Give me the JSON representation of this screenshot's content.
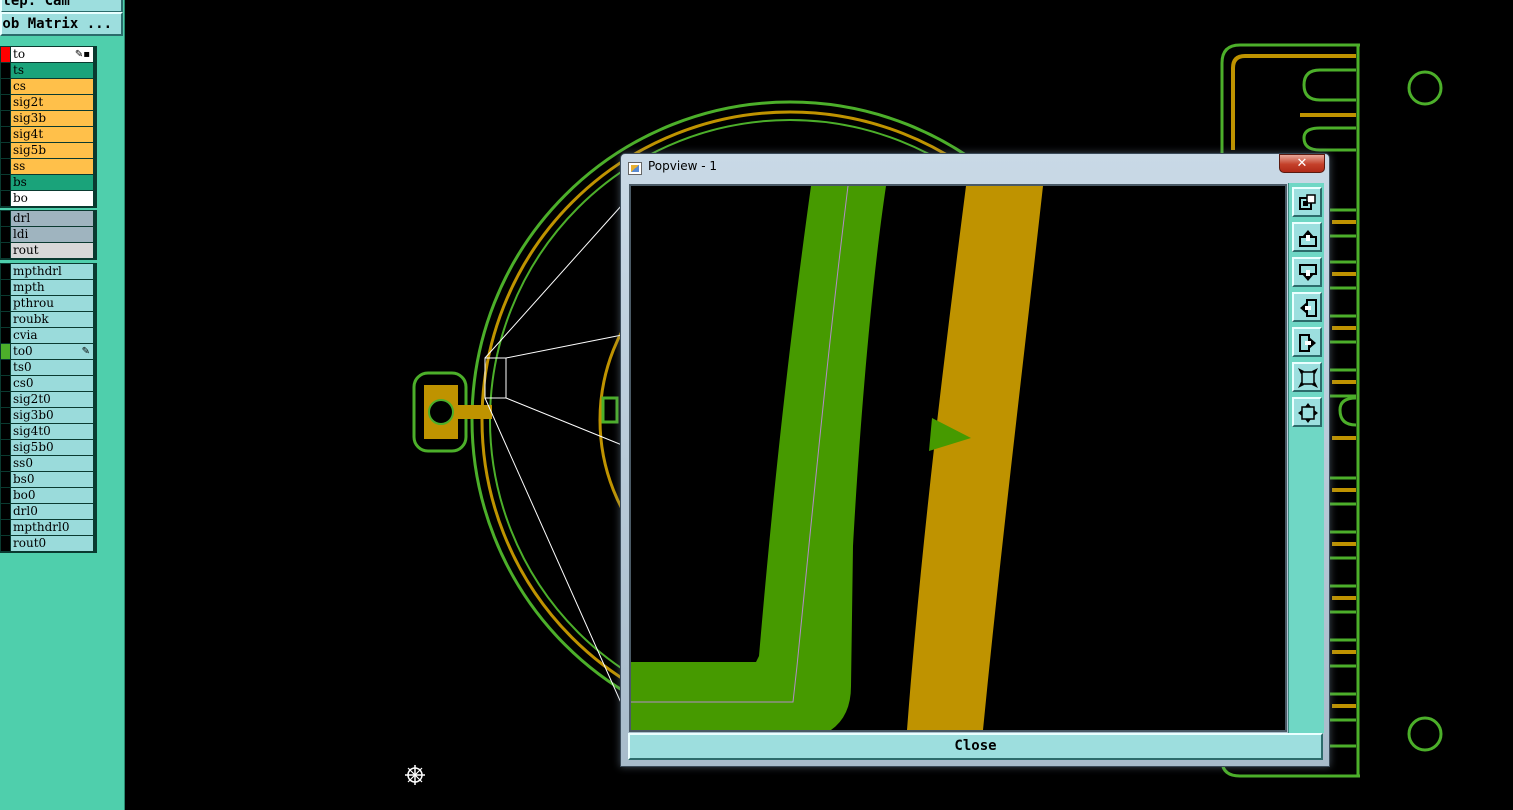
{
  "left_panel": {
    "step_button": "Step. Cam",
    "matrix_button": "Job Matrix ...",
    "groups": [
      {
        "rows": [
          {
            "name": "to",
            "bg": "#ffffff",
            "flag": "#ff0000",
            "mark": "✎▪"
          },
          {
            "name": "ts",
            "bg": "#1aa37a",
            "flag": "#000000",
            "mark": ""
          },
          {
            "name": "cs",
            "bg": "#ffc04a",
            "flag": "#000000",
            "mark": ""
          },
          {
            "name": "sig2t",
            "bg": "#ffc04a",
            "flag": "#000000",
            "mark": ""
          },
          {
            "name": "sig3b",
            "bg": "#ffc04a",
            "flag": "#000000",
            "mark": ""
          },
          {
            "name": "sig4t",
            "bg": "#ffc04a",
            "flag": "#000000",
            "mark": ""
          },
          {
            "name": "sig5b",
            "bg": "#ffc04a",
            "flag": "#000000",
            "mark": ""
          },
          {
            "name": "ss",
            "bg": "#ffc04a",
            "flag": "#000000",
            "mark": ""
          },
          {
            "name": "bs",
            "bg": "#1aa37a",
            "flag": "#000000",
            "mark": ""
          },
          {
            "name": "bo",
            "bg": "#ffffff",
            "flag": "#000000",
            "mark": ""
          }
        ]
      },
      {
        "rows": [
          {
            "name": "drl",
            "bg": "#9fb4bf",
            "flag": "#000000",
            "mark": ""
          },
          {
            "name": "ldi",
            "bg": "#9fb4bf",
            "flag": "#000000",
            "mark": ""
          },
          {
            "name": "rout",
            "bg": "#d8d8d8",
            "flag": "#000000",
            "mark": ""
          }
        ]
      },
      {
        "rows": [
          {
            "name": "mpthdrl",
            "bg": "#9adbdb",
            "flag": "#000000",
            "mark": ""
          },
          {
            "name": "mpth",
            "bg": "#9adbdb",
            "flag": "#000000",
            "mark": ""
          },
          {
            "name": "pthrou",
            "bg": "#9adbdb",
            "flag": "#000000",
            "mark": ""
          },
          {
            "name": "roubk",
            "bg": "#9adbdb",
            "flag": "#000000",
            "mark": ""
          },
          {
            "name": "cvia",
            "bg": "#9adbdb",
            "flag": "#000000",
            "mark": ""
          },
          {
            "name": "to0",
            "bg": "#9adbdb",
            "flag": "#4caf2a",
            "mark": "✎"
          },
          {
            "name": "ts0",
            "bg": "#9adbdb",
            "flag": "#000000",
            "mark": ""
          },
          {
            "name": "cs0",
            "bg": "#9adbdb",
            "flag": "#000000",
            "mark": ""
          },
          {
            "name": "sig2t0",
            "bg": "#9adbdb",
            "flag": "#000000",
            "mark": ""
          },
          {
            "name": "sig3b0",
            "bg": "#9adbdb",
            "flag": "#000000",
            "mark": ""
          },
          {
            "name": "sig4t0",
            "bg": "#9adbdb",
            "flag": "#000000",
            "mark": ""
          },
          {
            "name": "sig5b0",
            "bg": "#9adbdb",
            "flag": "#000000",
            "mark": ""
          },
          {
            "name": "ss0",
            "bg": "#9adbdb",
            "flag": "#000000",
            "mark": ""
          },
          {
            "name": "bs0",
            "bg": "#9adbdb",
            "flag": "#000000",
            "mark": ""
          },
          {
            "name": "bo0",
            "bg": "#9adbdb",
            "flag": "#000000",
            "mark": ""
          },
          {
            "name": "drl0",
            "bg": "#9adbdb",
            "flag": "#000000",
            "mark": ""
          },
          {
            "name": "mpthdrl0",
            "bg": "#9adbdb",
            "flag": "#000000",
            "mark": ""
          },
          {
            "name": "rout0",
            "bg": "#9adbdb",
            "flag": "#000000",
            "mark": ""
          }
        ]
      }
    ]
  },
  "popview": {
    "title": "Popview - 1",
    "close_x": "✕",
    "close_label": "Close",
    "tools": [
      "zoom-home-icon",
      "pan-up-icon",
      "pan-down-icon",
      "pan-left-icon",
      "pan-right-icon",
      "zoom-in-icon",
      "zoom-out-icon"
    ]
  },
  "colors": {
    "copper_green": "#469a00",
    "copper_gold": "#bf9300",
    "outline_green": "#4caf2a",
    "panel_bg": "#4fcfac",
    "button_bg": "#9ddede"
  }
}
